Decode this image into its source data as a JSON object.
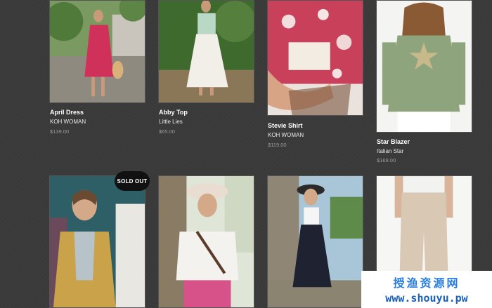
{
  "products": [
    {
      "name": "April Dress",
      "brand": "KOH WOMAN",
      "price": "$139.00"
    },
    {
      "name": "Abby Top",
      "brand": "Little Lies",
      "price": "$65.00"
    },
    {
      "name": "Stevie Shirt",
      "brand": "KOH WOMAN",
      "price": "$119.00"
    },
    {
      "name": "Star Blazer",
      "brand": "Italian Star",
      "price": "$169.00"
    },
    {
      "name": "",
      "brand": "",
      "price": ""
    },
    {
      "name": "",
      "brand": "",
      "price": ""
    },
    {
      "name": "",
      "brand": "",
      "price": ""
    },
    {
      "name": "",
      "brand": "",
      "price": ""
    }
  ],
  "badges": {
    "sold_out": "SOLD OUT"
  },
  "watermark": {
    "line1": "授渔资源网",
    "line2": "www.shouyu.pw"
  },
  "colors": {
    "background": "#3a3a3a",
    "badge": "#111111",
    "price": "#9a9a9a"
  }
}
